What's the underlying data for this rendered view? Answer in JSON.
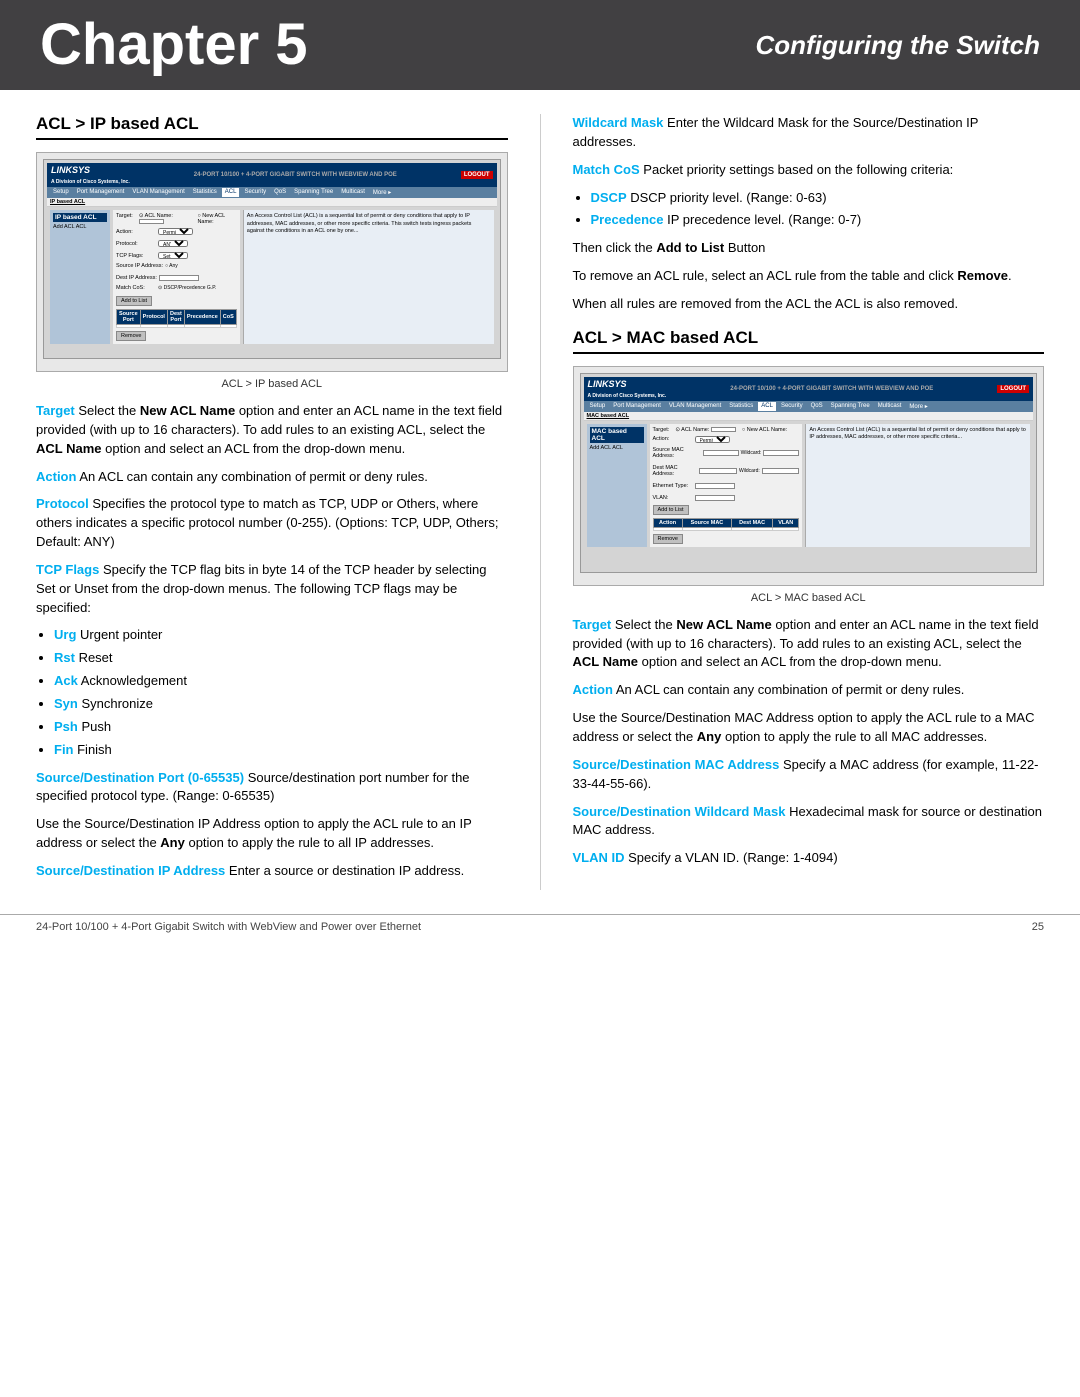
{
  "header": {
    "chapter": "Chapter 5",
    "section": "Configuring the Switch"
  },
  "left_col": {
    "section1_heading": "ACL > IP based ACL",
    "screenshot1_caption": "ACL > IP based ACL",
    "para1": {
      "label": "Target",
      "text": " Select the ",
      "bold": "New ACL Name",
      "text2": " option and enter an ACL name in the text field provided (with up to 16 characters). To add rules to an existing ACL, select the ",
      "bold2": "ACL Name",
      "text3": " option and select an ACL from the drop-down menu."
    },
    "para2": {
      "label": "Action",
      "text": "  An ACL can contain any combination of permit or deny rules."
    },
    "para3": {
      "label": "Protocol",
      "text": "  Specifies the protocol type to match as TCP, UDP or Others, where others indicates a specific protocol number (0-255). (Options: TCP, UDP, Others; Default: ANY)"
    },
    "para4": {
      "label": "TCP Flags",
      "text": "  Specify the TCP flag bits in byte 14 of the TCP header by selecting Set or Unset from the drop-down menus.  The following TCP flags may be specified:"
    },
    "tcp_flags": [
      {
        "label": "Urg",
        "text": "  Urgent pointer"
      },
      {
        "label": "Rst",
        "text": "  Reset"
      },
      {
        "label": "Ack",
        "text": "  Acknowledgement"
      },
      {
        "label": "Syn",
        "text": "  Synchronize"
      },
      {
        "label": "Psh",
        "text": "  Push"
      },
      {
        "label": "Fin",
        "text": "  Finish"
      }
    ],
    "para5": {
      "label": "Source/Destination Port (0-65535)",
      "text": "  Source/destination port number for the specified protocol type. (Range: 0-65535)"
    },
    "para6": {
      "text": "Use the Source/Destination IP Address option to apply the ACL rule to an IP address or select the ",
      "bold": "Any",
      "text2": " option to apply the rule to all IP addresses."
    },
    "para7": {
      "label": "Source/Destination IP Address",
      "text": "  Enter a source or destination IP address."
    },
    "para8": {
      "label": "Wildcard Mask",
      "text": "  Enter the Wildcard Mask for the Source/Destination IP addresses."
    },
    "para9": {
      "label": "Match CoS",
      "text": "  Packet priority settings based on the following criteria:"
    },
    "cos_items": [
      {
        "label": "DSCP",
        "text": "  DSCP priority level. (Range: 0-63)"
      },
      {
        "label": "Precedence",
        "text": "  IP precedence level. (Range: 0-7)"
      }
    ],
    "para10": {
      "text": "Then click the ",
      "bold": "Add to List",
      "text2": " Button"
    },
    "para11": {
      "text": "To remove an ACL rule, select an ACL rule from the table and click ",
      "bold": "Remove",
      "text2": "."
    },
    "para12": {
      "text": "When all rules are removed from the ACL the ACL is also removed."
    }
  },
  "right_col": {
    "section2_heading": "ACL > MAC based ACL",
    "screenshot2_caption": "ACL > MAC based ACL",
    "para1": {
      "label": "Target",
      "text": " Select the ",
      "bold": "New ACL Name",
      "text2": " option and enter an ACL name in the text field provided (with up to 16 characters). To add rules to an existing ACL, select the ",
      "bold2": "ACL Name",
      "text3": " option and select an ACL from the drop-down menu."
    },
    "para2": {
      "label": "Action",
      "text": "  An ACL can contain any combination of permit or deny rules."
    },
    "para3": {
      "text": "Use the Source/Destination MAC Address option to apply the ACL rule to a MAC address or select the ",
      "bold": "Any",
      "text2": " option to apply the rule to all MAC addresses."
    },
    "para4": {
      "label": "Source/Destination MAC Address",
      "text": "  Specify a MAC address (for example, 11-22-33-44-55-66)."
    },
    "para5": {
      "label": "Source/Destination Wildcard Mask",
      "text": "  Hexadecimal mask for source or destination MAC address."
    },
    "para6": {
      "label": "VLAN ID",
      "text": "  Specify a VLAN ID. (Range: 1-4094)"
    }
  },
  "footer": {
    "left": "24-Port 10/100 + 4-Port Gigabit Switch with WebView and Power over Ethernet",
    "right": "25"
  },
  "linksys_ui": {
    "logo": "LINKSYS",
    "nav_items": [
      "Setup",
      "Port Management",
      "VLAN Management",
      "Statistics",
      "ACL",
      "Security",
      "QoS",
      "Spanning Tree",
      "Multicast",
      "More ▸"
    ],
    "active_nav": "ACL",
    "sidebar_title1": "IP based ACL",
    "sidebar_items": [
      "Add ACL ACL"
    ],
    "fields": [
      {
        "label": "Target:",
        "value": ""
      },
      {
        "label": "Action:",
        "value": ""
      },
      {
        "label": "Protocol:",
        "value": ""
      },
      {
        "label": "TCP Flags:",
        "value": ""
      },
      {
        "label": "Source IP:",
        "value": ""
      },
      {
        "label": "Destination IP:",
        "value": ""
      },
      {
        "label": "Match CoS:",
        "value": ""
      }
    ],
    "buttons": [
      "Add to List",
      "Remove"
    ],
    "table_headers": [
      "Source Port",
      "Protocol",
      "Destination Port",
      "Precedence",
      "CoS"
    ],
    "mac_fields": [
      {
        "label": "Target:",
        "value": ""
      },
      {
        "label": "Action:",
        "value": ""
      },
      {
        "label": "Source MAC Address:",
        "value": ""
      },
      {
        "label": "Dest MAC Address:",
        "value": ""
      },
      {
        "label": "Ethernet Type:",
        "value": ""
      },
      {
        "label": "VLAN:",
        "value": ""
      }
    ]
  }
}
